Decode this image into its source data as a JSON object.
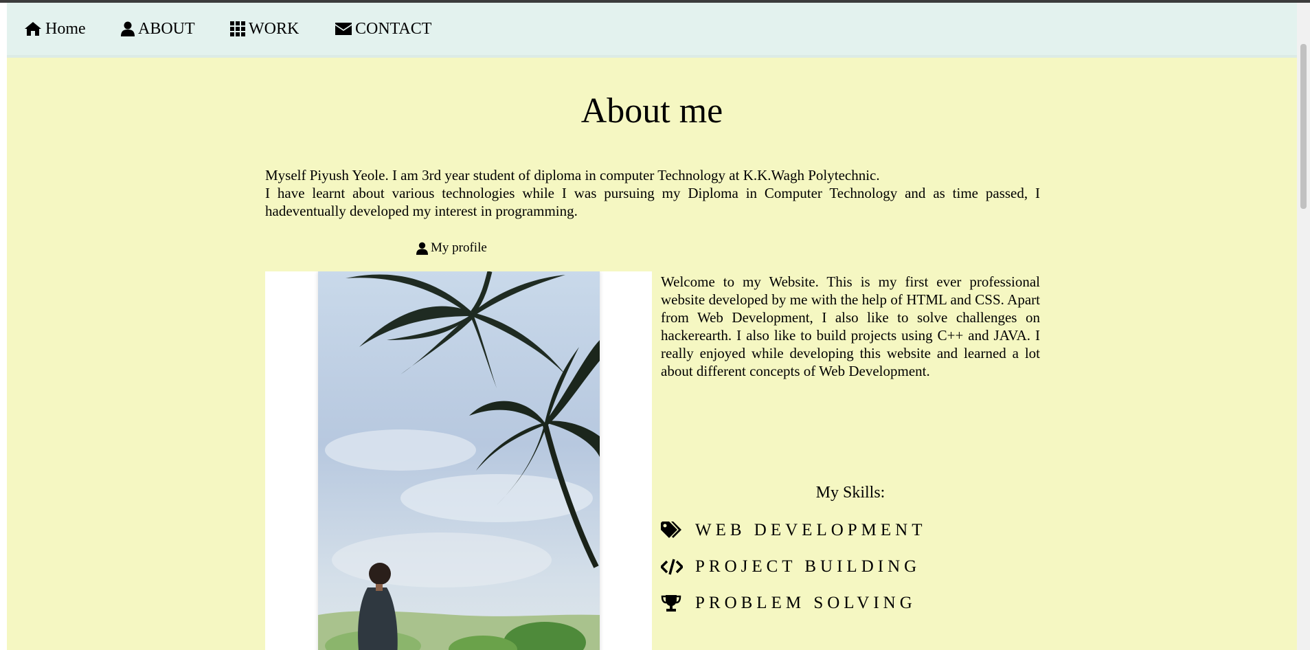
{
  "nav": {
    "items": [
      {
        "label": "Home",
        "icon": "home-icon"
      },
      {
        "label": "ABOUT",
        "icon": "user-icon"
      },
      {
        "label": "WORK",
        "icon": "grid-icon"
      },
      {
        "label": "CONTACT",
        "icon": "envelope-icon"
      }
    ]
  },
  "about": {
    "title": "About me",
    "intro_line1": "Myself Piyush Yeole. I am 3rd year student of diploma in computer Technology at K.K.Wagh Polytechnic.",
    "intro_line2": "I have learnt about various technologies while I was pursuing my Diploma in Computer Technology and as time passed, I hadeventually developed my interest in programming.",
    "profile_label": "My profile",
    "welcome_text": "Welcome to my Website. This is my first ever professional website developed by me with the help of HTML and CSS. Apart from Web Development, I also like to solve challenges on hackerearth. I also like to build projects using C++ and JAVA. I really enjoyed while developing this website and learned a lot about different concepts of Web Development.",
    "skills_title": "My Skills:",
    "skills": [
      {
        "label": "WEB DEVELOPMENT",
        "icon": "tags-icon"
      },
      {
        "label": "PROJECT BUILDING",
        "icon": "code-icon"
      },
      {
        "label": "PROBLEM SOLVING",
        "icon": "trophy-icon"
      }
    ]
  },
  "colors": {
    "page_background": "#f5f7c2",
    "navbar_background": "#e3f2ee"
  }
}
